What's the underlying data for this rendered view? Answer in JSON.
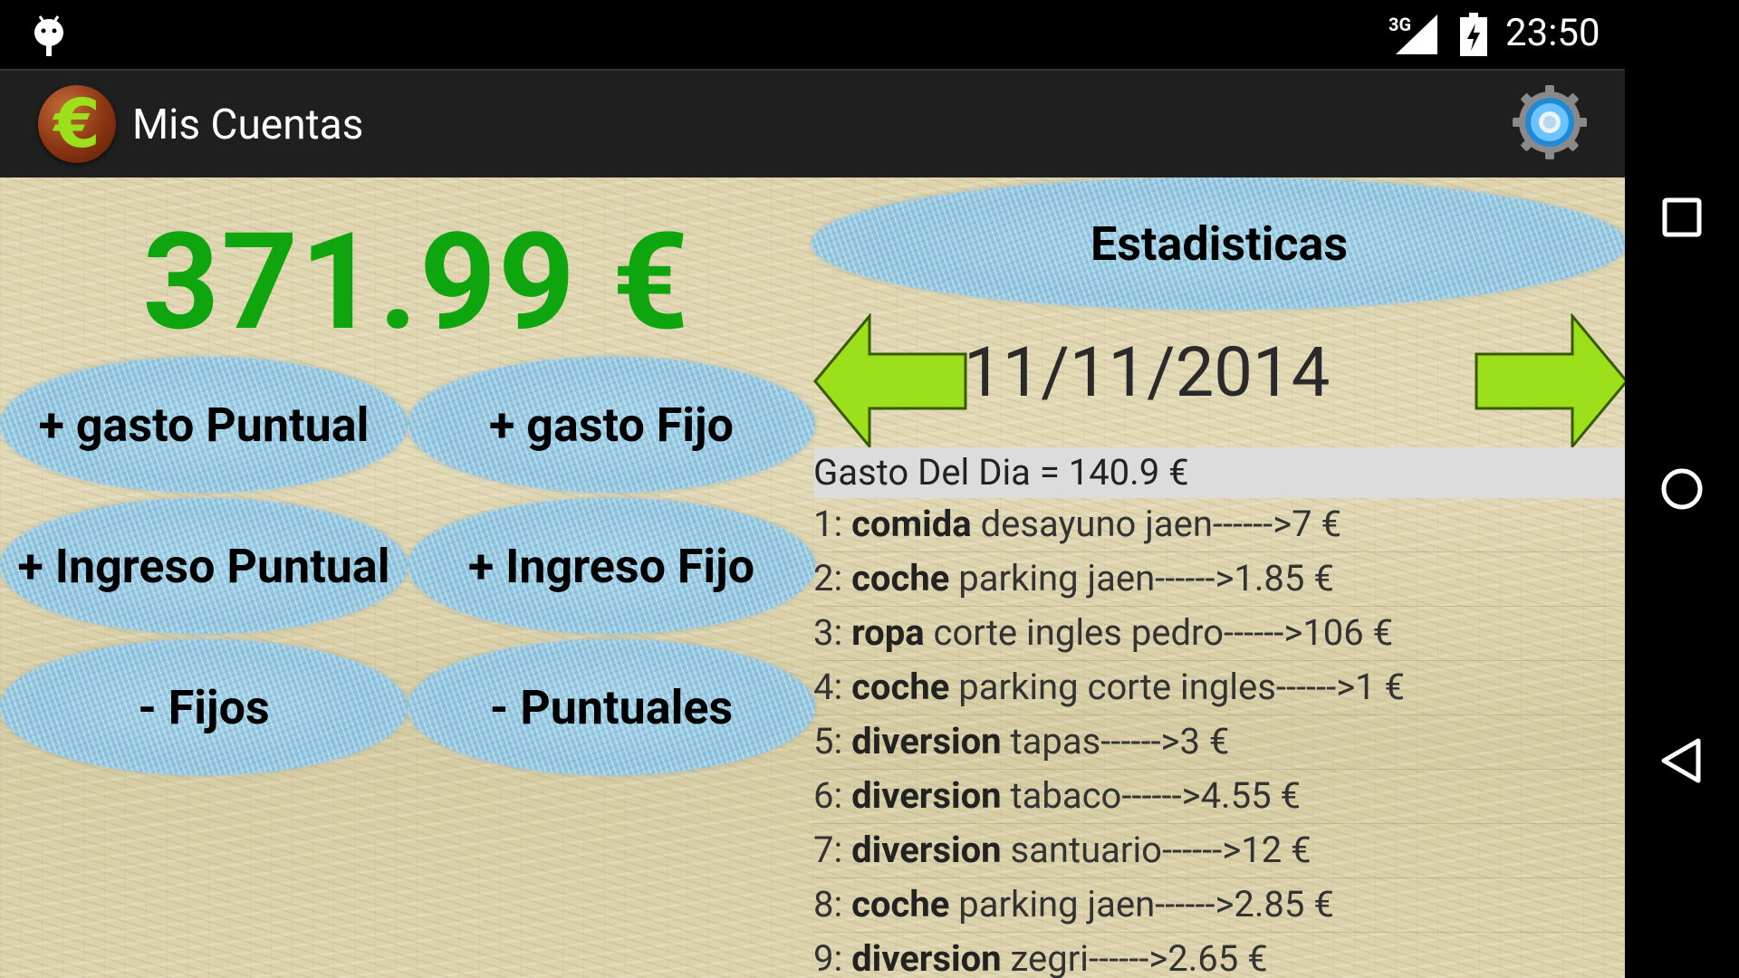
{
  "status_bar": {
    "network": "3G",
    "time": "23:50"
  },
  "app": {
    "title": "Mis Cuentas",
    "icon_glyph": "€"
  },
  "balance": "371.99 €",
  "buttons": {
    "gasto_puntual": "+ gasto Puntual",
    "gasto_fijo": "+ gasto Fijo",
    "ingreso_puntual": "+ Ingreso Puntual",
    "ingreso_fijo": "+ Ingreso Fijo",
    "fijos": "- Fijos",
    "puntuales": "- Puntuales",
    "estadisticas": "Estadisticas"
  },
  "date": "11/11/2014",
  "list": {
    "header": "Gasto Del Dia = 140.9 €",
    "items": [
      {
        "num": "1:",
        "category": "comida",
        "detail": "desayuno jaen------>7 €"
      },
      {
        "num": "2:",
        "category": "coche",
        "detail": "parking jaen------>1.85 €"
      },
      {
        "num": "3:",
        "category": "ropa",
        "detail": "corte ingles pedro------>106 €"
      },
      {
        "num": "4:",
        "category": "coche",
        "detail": "parking corte ingles------>1 €"
      },
      {
        "num": "5:",
        "category": "diversion",
        "detail": "tapas------>3 €"
      },
      {
        "num": "6:",
        "category": "diversion",
        "detail": "tabaco------>4.55 €"
      },
      {
        "num": "7:",
        "category": "diversion",
        "detail": "santuario------>12 €"
      },
      {
        "num": "8:",
        "category": "coche",
        "detail": "parking jaen------>2.85 €"
      },
      {
        "num": "9:",
        "category": "diversion",
        "detail": "zegri------>2.65 €"
      }
    ]
  },
  "colors": {
    "balance": "#0ea50e",
    "arrow": "#9be01a",
    "oval": "#93c8df"
  },
  "icons": [
    "android-debug-icon",
    "signal-icon",
    "battery-charging-icon",
    "euro-app-icon",
    "settings-gear-icon",
    "left-arrow-icon",
    "right-arrow-icon",
    "recents-icon",
    "home-icon",
    "back-icon"
  ]
}
